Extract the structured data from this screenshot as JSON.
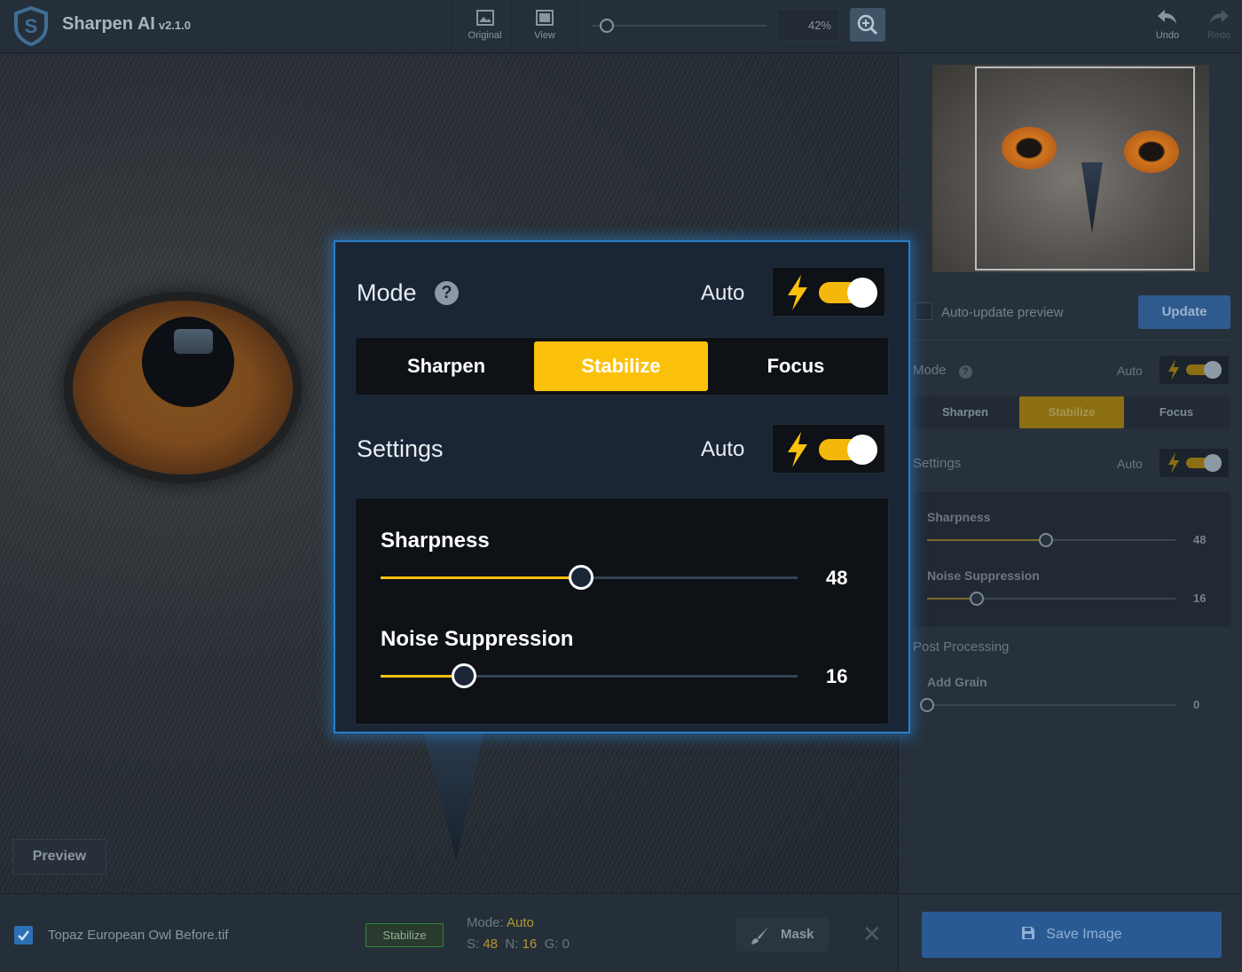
{
  "app": {
    "name": "Sharpen AI",
    "version": "v2.1.0"
  },
  "toolbar": {
    "original_label": "Original",
    "view_label": "View",
    "zoom_value": "42%",
    "zoom_level": 0.08,
    "undo_label": "Undo",
    "redo_label": "Redo"
  },
  "canvas": {
    "preview_label": "Preview"
  },
  "popup": {
    "mode_title": "Mode",
    "help_glyph": "?",
    "mode_auto_label": "Auto",
    "mode_auto_enabled": true,
    "modes": [
      "Sharpen",
      "Stabilize",
      "Focus"
    ],
    "active_mode": "Stabilize",
    "settings_title": "Settings",
    "settings_auto_label": "Auto",
    "settings_auto_enabled": true,
    "sliders": [
      {
        "label": "Sharpness",
        "value": "48",
        "level": 0.48
      },
      {
        "label": "Noise Suppression",
        "value": "16",
        "level": 0.2
      }
    ]
  },
  "panel": {
    "auto_update_label": "Auto-update preview",
    "auto_update_checked": false,
    "update_button": "Update",
    "mode_label": "Mode",
    "mode_auto_label": "Auto",
    "modes": [
      "Sharpen",
      "Stabilize",
      "Focus"
    ],
    "settings_label": "Settings",
    "settings_auto_label": "Auto",
    "sliders": [
      {
        "label": "Sharpness",
        "value": "48",
        "level": 0.48
      },
      {
        "label": "Noise Suppression",
        "value": "16",
        "level": 0.2
      }
    ],
    "post_processing_label": "Post Processing",
    "grain": {
      "label": "Add Grain",
      "value": "0",
      "level": 0.0
    },
    "save_button": "Save Image"
  },
  "file_bar": {
    "file_name": "Topaz European Owl Before.tif",
    "file_checked": true,
    "mode_badge": "Stabilize",
    "mode_prefix": "Mode: ",
    "mode_value": "Auto",
    "s_prefix": "S: ",
    "s_value": "48",
    "n_prefix": "N: ",
    "n_value": "16",
    "g_prefix": "G: ",
    "g_value": "0",
    "mask_label": "Mask",
    "close_glyph": "✕"
  },
  "colors": {
    "accent_yellow": "#fbc10a",
    "accent_blue": "#2a7ec8",
    "badge_green": "#2c8a3a"
  },
  "icons": [
    "logo-s-icon",
    "image-icon",
    "view-icon",
    "zoom-in-icon",
    "undo-icon",
    "redo-icon",
    "help-icon",
    "bolt-icon",
    "brush-icon",
    "save-icon",
    "close-icon",
    "check-icon"
  ]
}
